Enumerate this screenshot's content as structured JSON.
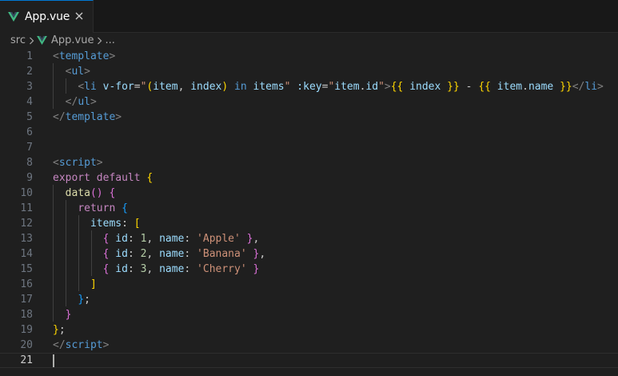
{
  "tab": {
    "title": "App.vue",
    "icon": "vue-icon",
    "close_icon": "close-icon"
  },
  "breadcrumb": {
    "folder": "src",
    "file": "App.vue",
    "more": "..."
  },
  "colors": {
    "background": "#1f1f1f",
    "tag": "#569cd6",
    "attribute": "#9cdcfe",
    "string": "#ce9178",
    "keyword": "#c586c0",
    "function": "#dcdcaa",
    "number": "#b5cea8",
    "bracket_gold": "#ffd700",
    "bracket_purple": "#da70d6",
    "bracket_blue": "#179fff",
    "vue_green": "#41b883"
  },
  "editor": {
    "active_line": 21,
    "lines": [
      {
        "n": "1",
        "tokens": [
          {
            "t": "<",
            "c": "#808080"
          },
          {
            "t": "template",
            "c": "#569cd6"
          },
          {
            "t": ">",
            "c": "#808080"
          }
        ]
      },
      {
        "n": "2",
        "tokens": [
          {
            "t": "  ",
            "c": "#cccccc"
          },
          {
            "t": "<",
            "c": "#808080"
          },
          {
            "t": "ul",
            "c": "#569cd6"
          },
          {
            "t": ">",
            "c": "#808080"
          }
        ]
      },
      {
        "n": "3",
        "tokens": [
          {
            "t": "    ",
            "c": "#cccccc"
          },
          {
            "t": "<",
            "c": "#808080"
          },
          {
            "t": "li",
            "c": "#569cd6"
          },
          {
            "t": " ",
            "c": "#cccccc"
          },
          {
            "t": "v-for",
            "c": "#9cdcfe"
          },
          {
            "t": "=",
            "c": "#cccccc"
          },
          {
            "t": "\"",
            "c": "#ce9178"
          },
          {
            "t": "(",
            "c": "#ffd700"
          },
          {
            "t": "item",
            "c": "#9cdcfe"
          },
          {
            "t": ", ",
            "c": "#cccccc"
          },
          {
            "t": "index",
            "c": "#9cdcfe"
          },
          {
            "t": ")",
            "c": "#ffd700"
          },
          {
            "t": " ",
            "c": "#cccccc"
          },
          {
            "t": "in",
            "c": "#569cd6"
          },
          {
            "t": " ",
            "c": "#cccccc"
          },
          {
            "t": "items",
            "c": "#9cdcfe"
          },
          {
            "t": "\"",
            "c": "#ce9178"
          },
          {
            "t": " ",
            "c": "#cccccc"
          },
          {
            "t": ":key",
            "c": "#9cdcfe"
          },
          {
            "t": "=",
            "c": "#cccccc"
          },
          {
            "t": "\"",
            "c": "#ce9178"
          },
          {
            "t": "item",
            "c": "#9cdcfe"
          },
          {
            "t": ".",
            "c": "#cccccc"
          },
          {
            "t": "id",
            "c": "#9cdcfe"
          },
          {
            "t": "\"",
            "c": "#ce9178"
          },
          {
            "t": ">",
            "c": "#808080"
          },
          {
            "t": "{{",
            "c": "#ffd700"
          },
          {
            "t": " ",
            "c": "#cccccc"
          },
          {
            "t": "index",
            "c": "#9cdcfe"
          },
          {
            "t": " ",
            "c": "#cccccc"
          },
          {
            "t": "}}",
            "c": "#ffd700"
          },
          {
            "t": " - ",
            "c": "#cccccc"
          },
          {
            "t": "{{",
            "c": "#ffd700"
          },
          {
            "t": " ",
            "c": "#cccccc"
          },
          {
            "t": "item",
            "c": "#9cdcfe"
          },
          {
            "t": ".",
            "c": "#cccccc"
          },
          {
            "t": "name",
            "c": "#9cdcfe"
          },
          {
            "t": " ",
            "c": "#cccccc"
          },
          {
            "t": "}}",
            "c": "#ffd700"
          },
          {
            "t": "</",
            "c": "#808080"
          },
          {
            "t": "li",
            "c": "#569cd6"
          },
          {
            "t": ">",
            "c": "#808080"
          }
        ]
      },
      {
        "n": "4",
        "tokens": [
          {
            "t": "  ",
            "c": "#cccccc"
          },
          {
            "t": "</",
            "c": "#808080"
          },
          {
            "t": "ul",
            "c": "#569cd6"
          },
          {
            "t": ">",
            "c": "#808080"
          }
        ]
      },
      {
        "n": "5",
        "tokens": [
          {
            "t": "</",
            "c": "#808080"
          },
          {
            "t": "template",
            "c": "#569cd6"
          },
          {
            "t": ">",
            "c": "#808080"
          }
        ]
      },
      {
        "n": "6",
        "tokens": []
      },
      {
        "n": "7",
        "tokens": []
      },
      {
        "n": "8",
        "tokens": [
          {
            "t": "<",
            "c": "#808080"
          },
          {
            "t": "script",
            "c": "#569cd6"
          },
          {
            "t": ">",
            "c": "#808080"
          }
        ]
      },
      {
        "n": "9",
        "tokens": [
          {
            "t": "export",
            "c": "#c586c0"
          },
          {
            "t": " ",
            "c": "#cccccc"
          },
          {
            "t": "default",
            "c": "#c586c0"
          },
          {
            "t": " ",
            "c": "#cccccc"
          },
          {
            "t": "{",
            "c": "#ffd700"
          }
        ]
      },
      {
        "n": "10",
        "tokens": [
          {
            "t": "  ",
            "c": "#cccccc"
          },
          {
            "t": "data",
            "c": "#dcdcaa"
          },
          {
            "t": "()",
            "c": "#da70d6"
          },
          {
            "t": " ",
            "c": "#cccccc"
          },
          {
            "t": "{",
            "c": "#da70d6"
          }
        ]
      },
      {
        "n": "11",
        "tokens": [
          {
            "t": "    ",
            "c": "#cccccc"
          },
          {
            "t": "return",
            "c": "#c586c0"
          },
          {
            "t": " ",
            "c": "#cccccc"
          },
          {
            "t": "{",
            "c": "#179fff"
          }
        ]
      },
      {
        "n": "12",
        "tokens": [
          {
            "t": "      ",
            "c": "#cccccc"
          },
          {
            "t": "items",
            "c": "#9cdcfe"
          },
          {
            "t": ": ",
            "c": "#cccccc"
          },
          {
            "t": "[",
            "c": "#ffd700"
          }
        ]
      },
      {
        "n": "13",
        "tokens": [
          {
            "t": "        ",
            "c": "#cccccc"
          },
          {
            "t": "{",
            "c": "#da70d6"
          },
          {
            "t": " ",
            "c": "#cccccc"
          },
          {
            "t": "id",
            "c": "#9cdcfe"
          },
          {
            "t": ": ",
            "c": "#cccccc"
          },
          {
            "t": "1",
            "c": "#b5cea8"
          },
          {
            "t": ", ",
            "c": "#cccccc"
          },
          {
            "t": "name",
            "c": "#9cdcfe"
          },
          {
            "t": ": ",
            "c": "#cccccc"
          },
          {
            "t": "'Apple'",
            "c": "#ce9178"
          },
          {
            "t": " ",
            "c": "#cccccc"
          },
          {
            "t": "}",
            "c": "#da70d6"
          },
          {
            "t": ",",
            "c": "#cccccc"
          }
        ]
      },
      {
        "n": "14",
        "tokens": [
          {
            "t": "        ",
            "c": "#cccccc"
          },
          {
            "t": "{",
            "c": "#da70d6"
          },
          {
            "t": " ",
            "c": "#cccccc"
          },
          {
            "t": "id",
            "c": "#9cdcfe"
          },
          {
            "t": ": ",
            "c": "#cccccc"
          },
          {
            "t": "2",
            "c": "#b5cea8"
          },
          {
            "t": ", ",
            "c": "#cccccc"
          },
          {
            "t": "name",
            "c": "#9cdcfe"
          },
          {
            "t": ": ",
            "c": "#cccccc"
          },
          {
            "t": "'Banana'",
            "c": "#ce9178"
          },
          {
            "t": " ",
            "c": "#cccccc"
          },
          {
            "t": "}",
            "c": "#da70d6"
          },
          {
            "t": ",",
            "c": "#cccccc"
          }
        ]
      },
      {
        "n": "15",
        "tokens": [
          {
            "t": "        ",
            "c": "#cccccc"
          },
          {
            "t": "{",
            "c": "#da70d6"
          },
          {
            "t": " ",
            "c": "#cccccc"
          },
          {
            "t": "id",
            "c": "#9cdcfe"
          },
          {
            "t": ": ",
            "c": "#cccccc"
          },
          {
            "t": "3",
            "c": "#b5cea8"
          },
          {
            "t": ", ",
            "c": "#cccccc"
          },
          {
            "t": "name",
            "c": "#9cdcfe"
          },
          {
            "t": ": ",
            "c": "#cccccc"
          },
          {
            "t": "'Cherry'",
            "c": "#ce9178"
          },
          {
            "t": " ",
            "c": "#cccccc"
          },
          {
            "t": "}",
            "c": "#da70d6"
          }
        ]
      },
      {
        "n": "16",
        "tokens": [
          {
            "t": "      ",
            "c": "#cccccc"
          },
          {
            "t": "]",
            "c": "#ffd700"
          }
        ]
      },
      {
        "n": "17",
        "tokens": [
          {
            "t": "    ",
            "c": "#cccccc"
          },
          {
            "t": "}",
            "c": "#179fff"
          },
          {
            "t": ";",
            "c": "#cccccc"
          }
        ]
      },
      {
        "n": "18",
        "tokens": [
          {
            "t": "  ",
            "c": "#cccccc"
          },
          {
            "t": "}",
            "c": "#da70d6"
          }
        ]
      },
      {
        "n": "19",
        "tokens": [
          {
            "t": "}",
            "c": "#ffd700"
          },
          {
            "t": ";",
            "c": "#cccccc"
          }
        ]
      },
      {
        "n": "20",
        "tokens": [
          {
            "t": "</",
            "c": "#808080"
          },
          {
            "t": "script",
            "c": "#569cd6"
          },
          {
            "t": ">",
            "c": "#808080"
          }
        ]
      },
      {
        "n": "21",
        "tokens": []
      }
    ]
  }
}
